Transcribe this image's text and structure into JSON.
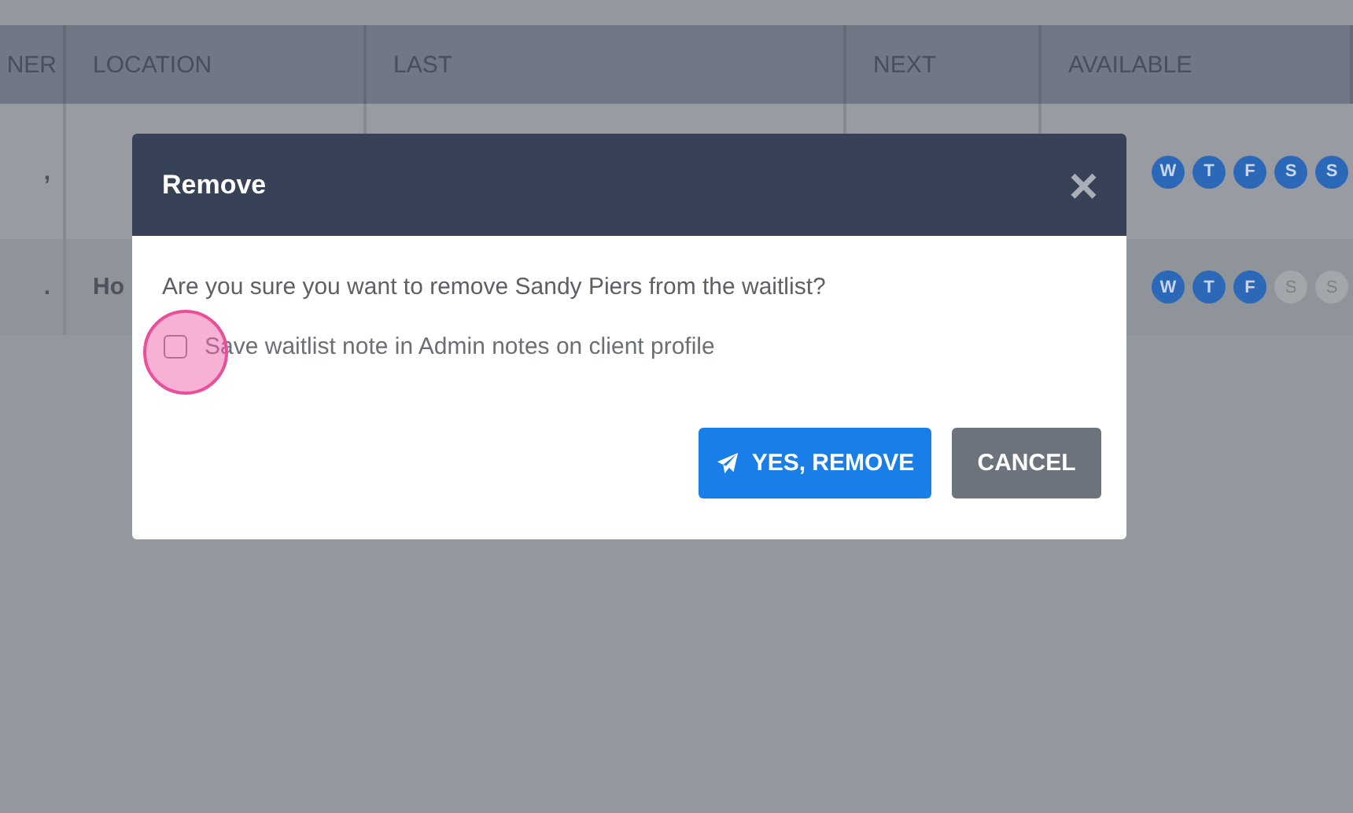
{
  "table": {
    "columns": [
      "NER",
      "LOCATION",
      "LAST",
      "NEXT",
      "AVAILABLE"
    ],
    "rows": [
      {
        "column_1": ",",
        "location": "",
        "days": [
          {
            "label": "W",
            "available": true
          },
          {
            "label": "T",
            "available": true
          },
          {
            "label": "F",
            "available": true
          },
          {
            "label": "S",
            "available": true
          },
          {
            "label": "S",
            "available": true
          }
        ]
      },
      {
        "column_1": ".",
        "location": "Ho",
        "days": [
          {
            "label": "W",
            "available": true
          },
          {
            "label": "T",
            "available": true
          },
          {
            "label": "F",
            "available": true
          },
          {
            "label": "S",
            "available": false
          },
          {
            "label": "S",
            "available": false
          }
        ]
      }
    ]
  },
  "dialog": {
    "title": "Remove",
    "close": "×",
    "message": "Are you sure you want to remove Sandy Piers from the waitlist?",
    "checkbox": {
      "label": "Save waitlist note in Admin notes on client profile",
      "checked": false
    },
    "buttons": [
      {
        "kind": "primary",
        "label": "YES, REMOVE"
      },
      {
        "kind": "secondary",
        "label": "CANCEL"
      }
    ]
  }
}
